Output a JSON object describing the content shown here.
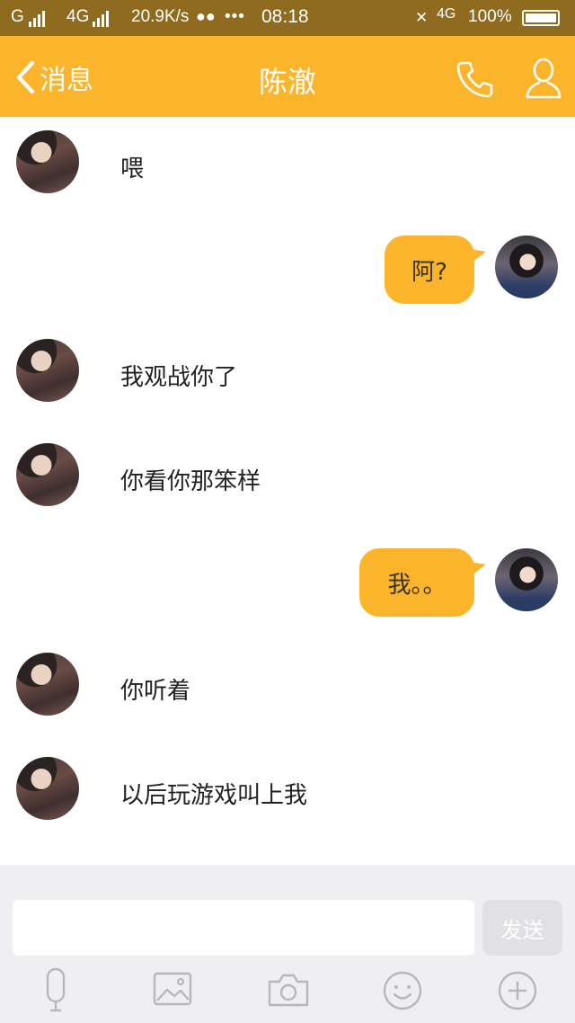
{
  "status_bar": {
    "carrier1": "G",
    "carrier2": "4G",
    "speed": "20.9K/s",
    "time": "08:18",
    "network": "4G",
    "battery": "100%"
  },
  "header": {
    "back_label": "消息",
    "title": "陈澈"
  },
  "messages": [
    {
      "from": "other",
      "text": "喂"
    },
    {
      "from": "me",
      "text": "阿?"
    },
    {
      "from": "other",
      "text": "我观战你了"
    },
    {
      "from": "other",
      "text": "你看你那笨样"
    },
    {
      "from": "me",
      "text": "我。。"
    },
    {
      "from": "other",
      "text": "你听着"
    },
    {
      "from": "other",
      "text": "以后玩游戏叫上我"
    }
  ],
  "composer": {
    "input_value": "",
    "send_label": "发送"
  },
  "toolbar": {
    "icons": [
      "microphone-icon",
      "image-icon",
      "camera-icon",
      "emoji-icon",
      "plus-icon"
    ]
  },
  "colors": {
    "accent": "#fcb52b",
    "status_bar": "#8f6b1f",
    "composer_bg": "#efeff1",
    "send_disabled": "#e1e1e4"
  }
}
